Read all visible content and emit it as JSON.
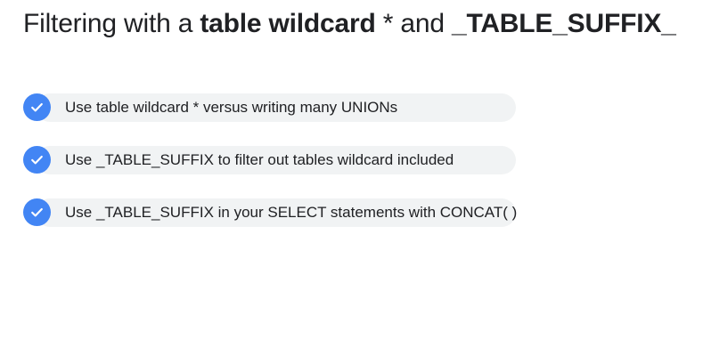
{
  "slide": {
    "title": {
      "part1": "Filtering with a ",
      "part2": "table wildcard",
      "part3": " * and ",
      "part4": "_TABLE_SUFFIX_"
    },
    "items": [
      {
        "text": "Use table wildcard * versus writing many UNIONs",
        "icon": "check-circle-icon"
      },
      {
        "text": "Use _TABLE_SUFFIX to filter out tables wildcard included",
        "icon": "check-circle-icon"
      },
      {
        "text": "Use _TABLE_SUFFIX in your SELECT statements with CONCAT( )",
        "icon": "check-circle-icon"
      }
    ],
    "colors": {
      "check_background": "#4285f4",
      "pill_background": "#f1f3f4",
      "text": "#202124"
    }
  }
}
